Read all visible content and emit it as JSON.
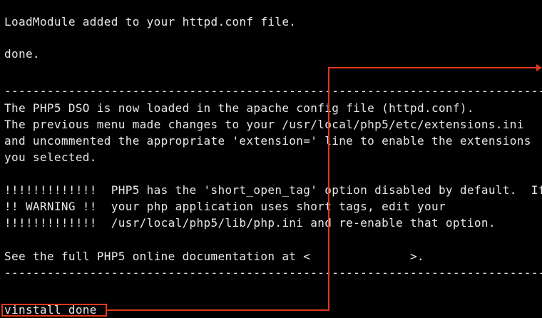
{
  "terminal": {
    "lines": [
      "LoadModule added to your httpd.conf file.",
      "done.",
      "------------------------------------------------------------------------------",
      "The PHP5 DSO is now loaded in the apache config file (httpd.conf).",
      "The previous menu made changes to your /usr/local/php5/etc/extensions.ini",
      "and uncommented the appropriate 'extension=' line to enable the extensions",
      "you selected.",
      "!!!!!!!!!!!!!  PHP5 has the 'short_open_tag' option disabled by default.  If",
      "!! WARNING !!  your php application uses short tags, edit your",
      "!!!!!!!!!!!!!  /usr/local/php5/lib/php.ini and re-enable that option.",
      "See the full PHP5 online documentation at <              >.",
      "------------------------------------------------------------------------------",
      "vinstall done"
    ]
  },
  "annotation": {
    "color": "#e0391a"
  }
}
